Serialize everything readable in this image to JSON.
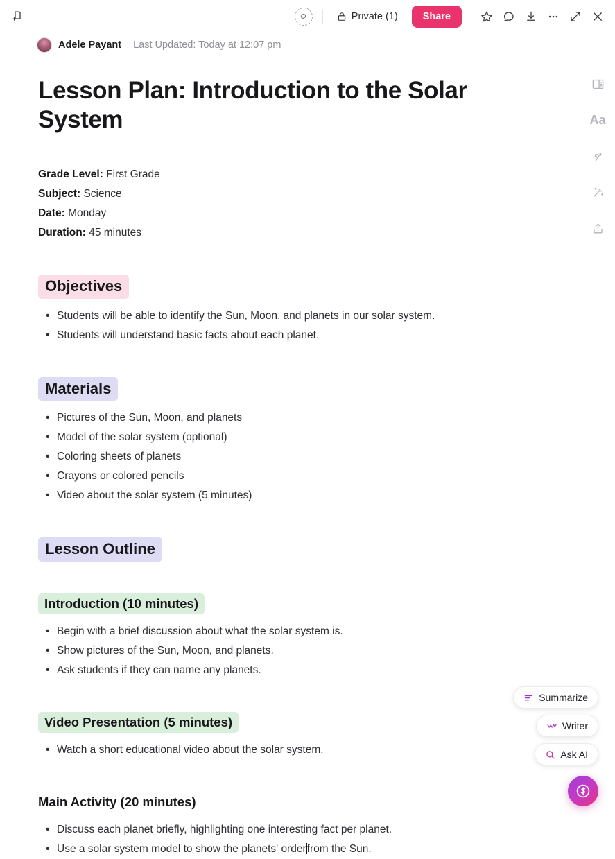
{
  "topbar": {
    "new_doc_icon": "new-page-icon",
    "presence_icon": "presence-avatar-icon",
    "private_label": "Private (1)",
    "share_label": "Share",
    "icons": [
      "star-icon",
      "comment-icon",
      "download-icon",
      "more-options-icon",
      "expand-icon",
      "close-icon"
    ]
  },
  "meta": {
    "author": "Adele Payant",
    "last_updated": "Last Updated: Today at 12:07 pm"
  },
  "document": {
    "title": "Lesson Plan: Introduction to the Solar System",
    "fields": [
      {
        "label": "Grade Level:",
        "value": "First Grade"
      },
      {
        "label": "Subject:",
        "value": "Science"
      },
      {
        "label": "Date:",
        "value": "Monday"
      },
      {
        "label": "Duration:",
        "value": "45 minutes"
      }
    ],
    "sections": [
      {
        "heading": "Objectives",
        "highlight": "#fadde6",
        "items": [
          "Students will be able to identify the Sun, Moon, and planets in our solar system.",
          "Students will understand basic facts about each planet."
        ]
      },
      {
        "heading": "Materials",
        "highlight": "#dedcf5",
        "items": [
          "Pictures of the Sun, Moon, and planets",
          "Model of the solar system (optional)",
          "Coloring sheets of planets",
          "Crayons or colored pencils",
          "Video about the solar system (5 minutes)"
        ]
      },
      {
        "heading": "Lesson Outline",
        "highlight": "#dedcf5",
        "items": []
      }
    ],
    "subsections": [
      {
        "heading": "Introduction (10 minutes)",
        "highlight": "#d9efdc",
        "items": [
          "Begin with a brief discussion about what the solar system is.",
          "Show pictures of the Sun, Moon, and planets.",
          "Ask students if they can name any planets."
        ]
      },
      {
        "heading": "Video Presentation (5 minutes)",
        "highlight": "#d9efdc",
        "items": [
          "Watch a short educational video about the solar system."
        ]
      },
      {
        "heading": "Main Activity (20 minutes)",
        "highlight": "none",
        "items": [
          "Discuss each planet briefly, highlighting one interesting fact per planet.",
          "Use a solar system model to show the planets' order",
          "from the Sun."
        ]
      }
    ]
  },
  "right_rail": {
    "items": [
      "panel-layout-icon",
      "Aa",
      "convert-arrows-icon",
      "magic-wand-icon",
      "share-upload-icon"
    ]
  },
  "ai": {
    "summarize_label": "Summarize",
    "writer_label": "Writer",
    "ask_ai_label": "Ask AI",
    "fab_icon": "ai-assistant-icon",
    "accent": "#e8336d"
  }
}
